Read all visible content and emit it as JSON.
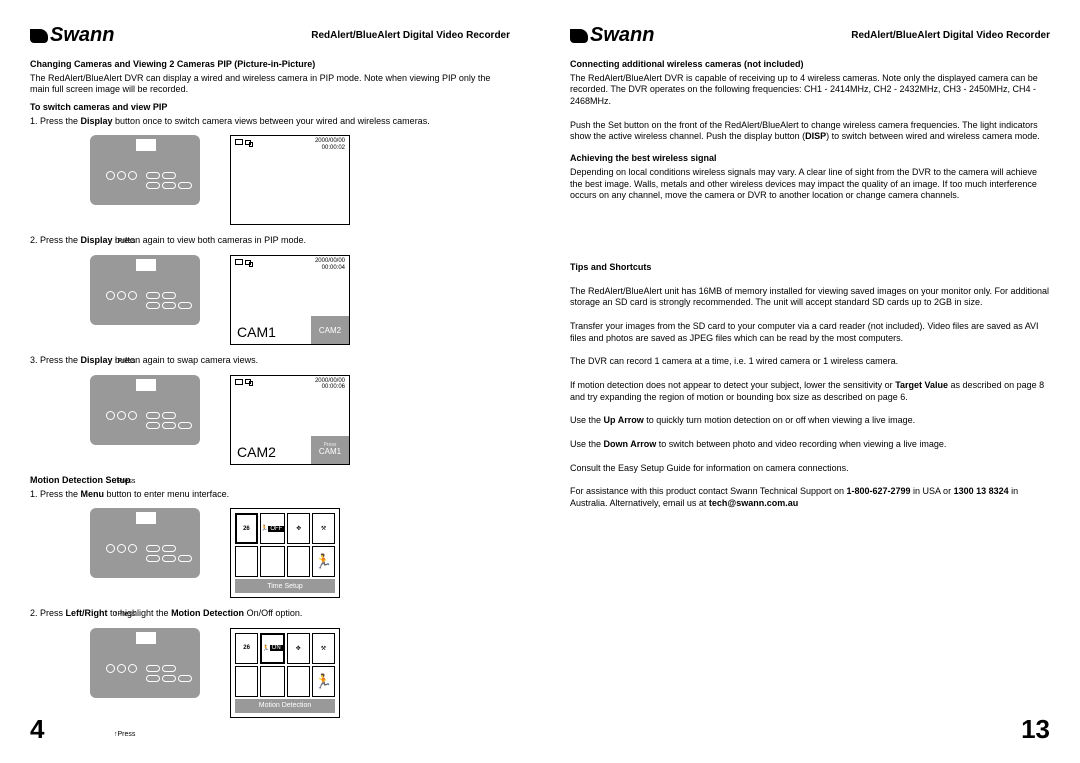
{
  "brand": "Swann",
  "doc_title": "RedAlert/BlueAlert Digital Video Recorder",
  "left": {
    "pagenum": "4",
    "s1_head": "Changing Cameras and Viewing 2 Cameras PIP (Picture-in-Picture)",
    "s1_p": "The RedAlert/BlueAlert DVR can display a wired and wireless camera in PIP mode.  Note when viewing PIP only the main full screen image will be recorded.",
    "s2_head": "To switch cameras and view PIP",
    "s2_step1a": "1. Press the ",
    "s2_step1b": "Display",
    "s2_step1c": " button once to switch camera views between your wired and wireless cameras.",
    "press": "Press",
    "ts1_date": "2000/00/00",
    "ts1_time": "00:00:02",
    "s2_step2a": "2. Press the ",
    "s2_step2b": "Display",
    "s2_step2c": " button again to view both cameras in PIP mode.",
    "ts2_date": "2000/00/00",
    "ts2_time": "00:00:04",
    "cam1": "CAM1",
    "cam2": "CAM2",
    "s2_step3a": "3. Press the ",
    "s2_step3b": "Display",
    "s2_step3c": " button again to swap camera views.",
    "ts3_date": "2000/00/00",
    "ts3_time": "00:00:06",
    "s3_head": "Motion Detection Setup",
    "s3_step1a": "1. Press the ",
    "s3_step1b": "Menu",
    "s3_step1c": " button to enter menu interface.",
    "menu1_c1": "26",
    "menu1_c2": "OFF",
    "menu1_footer": "Time Setup",
    "s3_step2a": "2. Press ",
    "s3_step2b": "Left/Right",
    "s3_step2c": " to highlight the ",
    "s3_step2d": "Motion Detection",
    "s3_step2e": " On/Off option.",
    "menu2_c1": "26",
    "menu2_c2": "ON",
    "menu2_footer": "Motion Detection"
  },
  "right": {
    "pagenum": "13",
    "s1_head": "Connecting additional wireless cameras (not included)",
    "s1_p1": "The RedAlert/BlueAlert DVR is capable of receiving up to 4 wireless cameras.  Note only the displayed camera can be recorded. The DVR operates on the following frequencies: CH1 - 2414MHz, CH2 - 2432MHz, CH3 - 2450MHz, CH4 - 2468MHz.",
    "s1_p2a": "Push the Set button on the front of the RedAlert/BlueAlert to change wireless camera frequencies.  The light indicators show the active wireless channel.  Push the display button (",
    "s1_p2b": "DISP",
    "s1_p2c": ") to switch between wired and wireless camera mode.",
    "s2_head": "Achieving the best wireless signal",
    "s2_p": "Depending on local conditions wireless signals may vary.  A clear line of sight from the DVR to the camera will achieve the best image.  Walls, metals and other wireless devices may impact the quality of an image.  If too much interference occurs on any channel, move the camera or DVR to another location or change camera channels.",
    "s3_head": "Tips and Shortcuts",
    "s3_p1": "The RedAlert/BlueAlert unit has 16MB of memory installed for viewing saved images on your monitor only.  For additional storage an SD card is strongly recommended.  The unit will accept standard SD cards up to 2GB in size.",
    "s3_p2": "Transfer your images from the SD card to your computer via a card reader (not included). Video files are saved as AVI files and photos are saved as JPEG files which can be read by the most computers.",
    "s3_p3": "The DVR can record 1 camera at a time, i.e. 1 wired camera or 1 wireless camera.",
    "s3_p4a": "If motion detection does not appear to detect your subject, lower the sensitivity or ",
    "s3_p4b": "Target Value",
    "s3_p4c": " as described on page 8 and try expanding the region of motion or bounding box size as described on page 6.",
    "s3_p5a": "Use the ",
    "s3_p5b": "Up Arrow",
    "s3_p5c": " to quickly turn motion detection on or off when viewing a live image.",
    "s3_p6a": "Use the ",
    "s3_p6b": "Down Arrow",
    "s3_p6c": " to switch between photo and video recording when viewing a live image.",
    "s3_p7": "Consult the Easy Setup Guide for information on camera connections.",
    "s3_p8a": "For assistance with this product contact Swann Technical Support on ",
    "s3_p8b": "1-800-627-2799",
    "s3_p8c": " in USA or ",
    "s3_p8d": "1300 13 8324",
    "s3_p8e": " in Australia.  Alternatively, email us at ",
    "s3_p8f": "tech@swann.com.au"
  }
}
